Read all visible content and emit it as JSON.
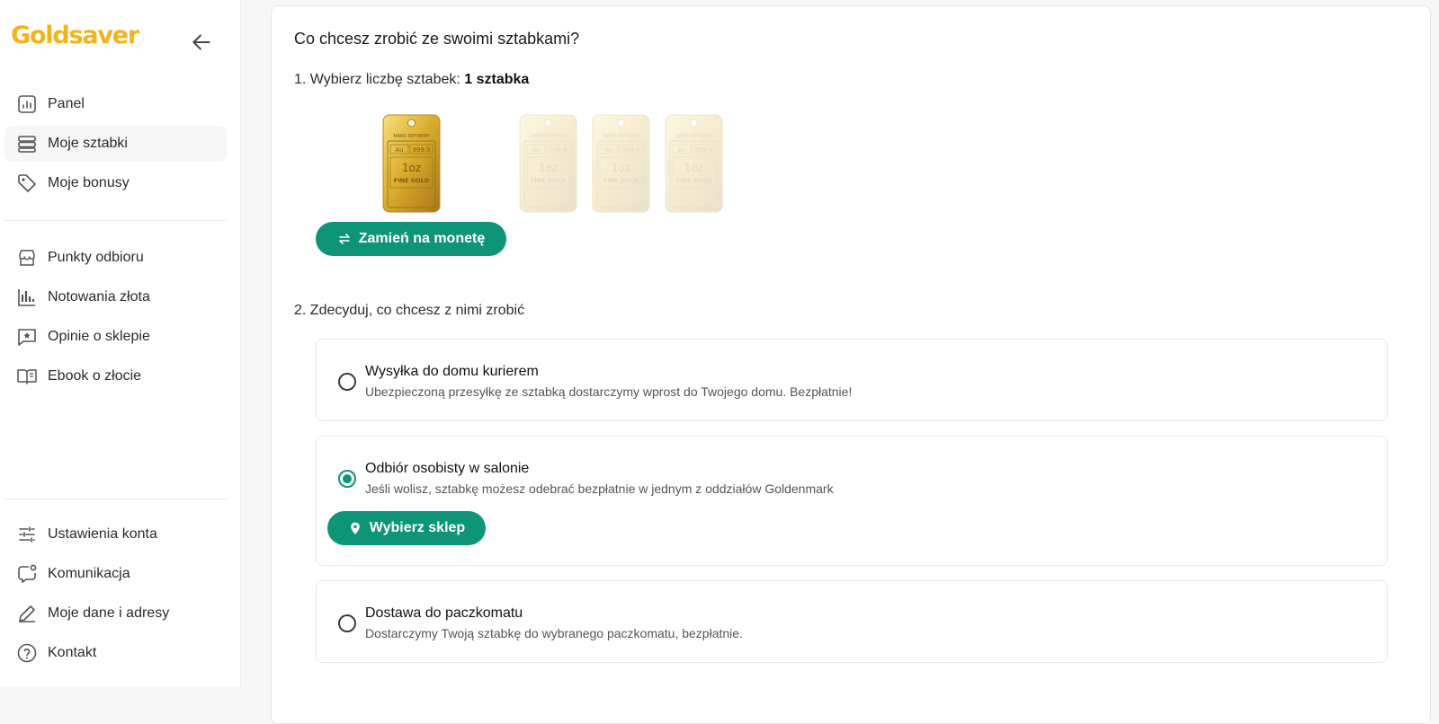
{
  "brand": {
    "logo_text": "Goldsaver",
    "accent_color": "#f0b41c",
    "primary_color": "#0e9477"
  },
  "sidebar": {
    "back_icon": "arrow-left-icon",
    "primary": [
      {
        "label": "Panel",
        "icon": "chart-panel-icon",
        "active": false
      },
      {
        "label": "Moje sztabki",
        "icon": "stack-bars-icon",
        "active": true
      },
      {
        "label": "Moje bonusy",
        "icon": "tag-icon",
        "active": false
      }
    ],
    "secondary": [
      {
        "label": "Punkty odbioru",
        "icon": "store-icon"
      },
      {
        "label": "Notowania złota",
        "icon": "bar-chart-icon"
      },
      {
        "label": "Opinie o sklepie",
        "icon": "star-message-icon"
      },
      {
        "label": "Ebook o złocie",
        "icon": "book-icon"
      }
    ],
    "bottom": [
      {
        "label": "Ustawienia konta",
        "icon": "sliders-icon"
      },
      {
        "label": "Komunikacja",
        "icon": "chat-bell-icon"
      },
      {
        "label": "Moje dane i adresy",
        "icon": "pen-icon"
      },
      {
        "label": "Kontakt",
        "icon": "help-circle-icon"
      }
    ]
  },
  "main": {
    "title": "Co chcesz zrobić ze swoimi sztabkami?",
    "step1": {
      "label": "1. Wybierz liczbę sztabek: ",
      "value": "1 sztabka"
    },
    "bar_text": {
      "brand": "MAKO REFINERY",
      "metal": "Au",
      "purity": "999.9",
      "weight": "1oz",
      "grade": "FINE GOLD"
    },
    "bars_total": 4,
    "bars_selected": 1,
    "swap_button": {
      "label": "Zamień na monetę",
      "icon": "swap-arrows-icon"
    },
    "step2": {
      "label": "2. Zdecyduj, co chcesz z nimi zrobić"
    },
    "options": [
      {
        "title": "Wysyłka do domu kurierem",
        "desc": "Ubezpieczoną przesyłkę ze sztabką dostarczymy wprost do Twojego domu. Bezpłatnie!",
        "selected": false
      },
      {
        "title": "Odbiór osobisty w salonie",
        "desc": "Jeśli wolisz, sztabkę możesz odebrać bezpłatnie w jednym z oddziałów Goldenmark",
        "selected": true,
        "button": {
          "label": "Wybierz sklep",
          "icon": "map-pin-icon"
        }
      },
      {
        "title": "Dostawa do paczkomatu",
        "desc": "Dostarczymy Twoją sztabkę do wybranego paczkomatu, bezpłatnie.",
        "selected": false
      }
    ]
  }
}
